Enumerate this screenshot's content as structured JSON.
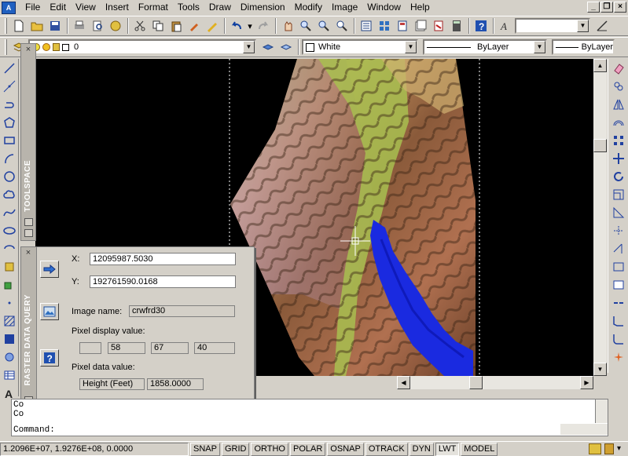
{
  "menu": {
    "items": [
      "File",
      "Edit",
      "View",
      "Insert",
      "Format",
      "Tools",
      "Draw",
      "Dimension",
      "Modify",
      "Image",
      "Window",
      "Help"
    ]
  },
  "toolbar2": {
    "layer_value": "0",
    "color_value": "White",
    "linetype_value": "ByLayer",
    "lineweight_value": "ByLayer"
  },
  "toolspace": {
    "title": "TOOLSPACE"
  },
  "raster_query": {
    "title": "RASTER DATA QUERY",
    "x_label": "X:",
    "x_value": "12095987.5030",
    "y_label": "Y:",
    "y_value": "192761590.0168",
    "image_name_label": "Image name:",
    "image_name_value": "crwfrd30",
    "pixel_display_label": "Pixel display value:",
    "pixel_display_values": [
      "",
      "58",
      "67",
      "40"
    ],
    "pixel_data_label": "Pixel data value:",
    "pixel_data_type": "Height (Feet)",
    "pixel_data_value": "1858.0000"
  },
  "command": {
    "history1": "Co",
    "history2": "Co",
    "prompt": "Command:"
  },
  "status": {
    "coords": "1.2096E+07, 1.9276E+08, 0.0000",
    "toggles": [
      "SNAP",
      "GRID",
      "ORTHO",
      "POLAR",
      "OSNAP",
      "OTRACK",
      "DYN",
      "LWT",
      "MODEL"
    ]
  },
  "colors": {
    "canvas": "#000000",
    "chrome": "#d4d0c8",
    "water": "#1a2ae0",
    "vegetation": "#8fb050"
  }
}
